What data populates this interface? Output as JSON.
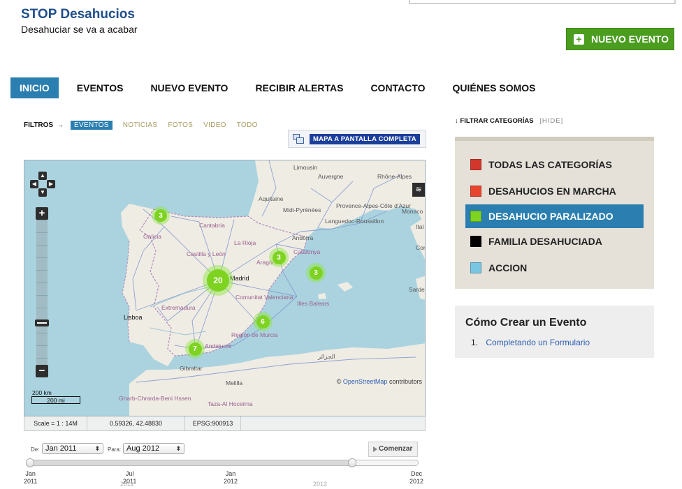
{
  "header": {
    "title": "STOP Desahucios",
    "tagline": "Desahuciar se va a acabar",
    "new_event_button": "NUEVO EVENTO"
  },
  "nav": {
    "items": [
      {
        "label": "INICIO",
        "active": true
      },
      {
        "label": "EVENTOS",
        "active": false
      },
      {
        "label": "NUEVO EVENTO",
        "active": false
      },
      {
        "label": "RECIBIR ALERTAS",
        "active": false
      },
      {
        "label": "CONTACTO",
        "active": false
      },
      {
        "label": "QUIÉNES SOMOS",
        "active": false
      }
    ]
  },
  "filters": {
    "label": "FILTROS",
    "items": [
      {
        "label": "EVENTOS",
        "active": true
      },
      {
        "label": "NOTICIAS",
        "active": false
      },
      {
        "label": "FOTOS",
        "active": false
      },
      {
        "label": "VIDEO",
        "active": false
      },
      {
        "label": "TODO",
        "active": false
      }
    ],
    "fullscreen_button": "MAPA A PANTALLA COMPLETA"
  },
  "map": {
    "clusters": [
      {
        "count": "3",
        "name": "cluster-galicia"
      },
      {
        "count": "20",
        "name": "cluster-madrid"
      },
      {
        "count": "3",
        "name": "cluster-aragon"
      },
      {
        "count": "3",
        "name": "cluster-mediterranean"
      },
      {
        "count": "6",
        "name": "cluster-murcia"
      },
      {
        "count": "7",
        "name": "cluster-andalucia"
      }
    ],
    "labels": {
      "limousin": "Limousin",
      "auvergne": "Auvergne",
      "rhone_alpes": "Rhône-Alpes",
      "aquitaine": "Aquitaine",
      "midi_pyrenees": "Midi-Pyrénées",
      "provence": "Provence-Alpes-Côte d'Azur",
      "monaco": "Monaco",
      "languedoc": "Languedoc-Roussillon",
      "galicia": "Galicia",
      "cantabria": "Cantabria",
      "andorra": "Andorra",
      "catalunya": "Catalunya",
      "castilla_leon": "Castilla y León",
      "la_rioja": "La Rioja",
      "aragon": "Aragón",
      "madrid": "Madrid",
      "extremadura": "Extremadura",
      "comunitat": "Comunitat Valenciana",
      "illes_balears": "Illes Balears",
      "lisboa": "Lisboa",
      "region_murcia": "Región de Murcia",
      "andalucia": "Andalucía",
      "gibraltar": "Gibraltar",
      "melilla": "Melilla",
      "alger": "الجزائر",
      "gharb": "Gharb-Chrarda-Beni Hssen",
      "taza": "Taza-Al Hoceïma",
      "sarde": "Sarde",
      "cors": "Cors",
      "ital": "Ital"
    },
    "attribution_prefix": "©",
    "attribution_link": "OpenStreetMap",
    "attribution_suffix": "contributors",
    "scale_km": "200 km",
    "scale_mi": "200 mi",
    "status": {
      "scale": "Scale = 1 : 14M",
      "coords": "0.59326, 42.48830",
      "epsg": "EPSG:900913"
    }
  },
  "timeline": {
    "from_label": "De:",
    "from_value": "Jan 2011",
    "to_label": "Para:",
    "to_value": "Aug 2012",
    "go_button": "Comenzar",
    "selected_fraction": 0.83,
    "ticks": [
      {
        "month": "Jan",
        "year": "2011"
      },
      {
        "month": "Jul",
        "year": "2011"
      },
      {
        "month": "",
        "year": "2011"
      },
      {
        "month": "Jan",
        "year": "2012"
      },
      {
        "month": "",
        "year": "2012"
      },
      {
        "month": "Dec",
        "year": "2012"
      }
    ]
  },
  "sidebar": {
    "categories_title": "FILTRAR CATEGORÍAS",
    "hide_link": "[HIDE]",
    "categories": [
      {
        "label": "TODAS LAS CATEGORÍAS",
        "color": "#d3372c",
        "active": false
      },
      {
        "label": "DESAHUCIOS EN MARCHA",
        "color": "#e8452f",
        "active": false
      },
      {
        "label": "DESAHUCIO PARALIZADO",
        "color": "#7ed321",
        "active": true
      },
      {
        "label": "FAMILIA DESAHUCIADA",
        "color": "#000000",
        "active": false
      },
      {
        "label": "ACCION",
        "color": "#79c6e2",
        "active": false
      }
    ],
    "howto_title": "Cómo Crear un Evento",
    "howto_items": [
      {
        "number": "1.",
        "label": "Completando un Formulario"
      }
    ]
  },
  "colors": {
    "accent": "#2a7fb0",
    "brand_title": "#1f4e8c",
    "new_event_green": "#4a9d1f",
    "cluster_green": "#7ed321"
  }
}
